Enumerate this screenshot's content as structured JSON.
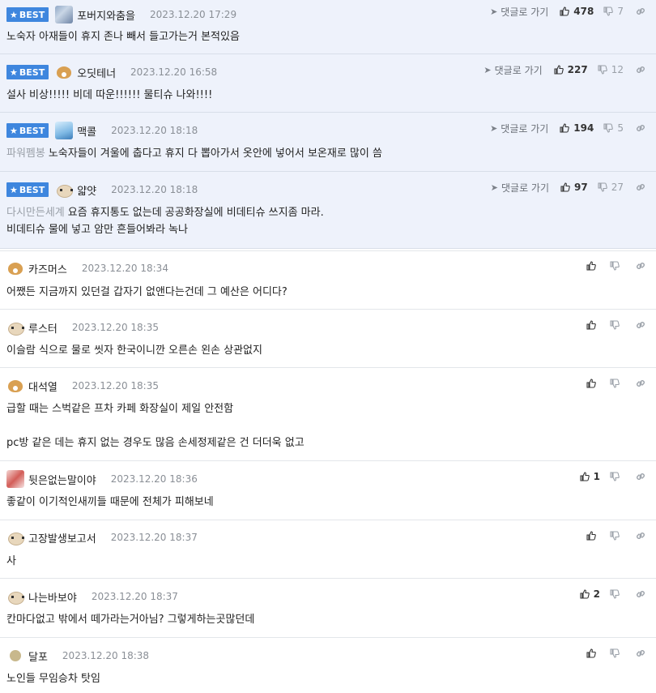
{
  "labels": {
    "best": "BEST",
    "reply": "댓글로 가기"
  },
  "colors": {
    "accent": "#3e86de",
    "best_bg": "#eef2fb"
  },
  "comments": [
    {
      "best": true,
      "avatar": "koala-avatar",
      "nick": "포버지와춤을",
      "date": "2023.12.20 17:29",
      "mention": "",
      "text": "노숙자 아재들이 휴지 존나 빼서 들고가는거 본적있음",
      "up": "478",
      "down": "7"
    },
    {
      "best": true,
      "avatar": "fox-avatar",
      "nick": "오딧테너",
      "date": "2023.12.20 16:58",
      "mention": "",
      "text": "설사 비상!!!!! 비데 따운!!!!!! 물티슈 나와!!!!",
      "up": "227",
      "down": "12"
    },
    {
      "best": true,
      "avatar": "blue-avatar",
      "nick": "맥콜",
      "date": "2023.12.20 18:18",
      "mention": "파워펨봉",
      "text": "노숙자들이 겨울에 춥다고 휴지 다 뽑아가서 옷안에 넣어서 보온재로 많이 씀",
      "up": "194",
      "down": "5"
    },
    {
      "best": true,
      "avatar": "puppy-avatar",
      "nick": "얇얏",
      "date": "2023.12.20 18:18",
      "mention": "다시만든세계",
      "text": "요즘 휴지통도 없는데 공공화장실에 비데티슈 쓰지좀 마라.\n비데티슈 물에 넣고 암만 흔들어봐라 녹나",
      "up": "97",
      "down": "27"
    },
    {
      "best": false,
      "avatar": "fox-avatar",
      "nick": "카즈머스",
      "date": "2023.12.20 18:34",
      "mention": "",
      "text": "어쨌든 지금까지 있던걸 갑자기 없앤다는건데 그 예산은 어디다?",
      "up": "",
      "down": ""
    },
    {
      "best": false,
      "avatar": "puppy-avatar",
      "nick": "루스터",
      "date": "2023.12.20 18:35",
      "mention": "",
      "text": "이슬람 식으로 물로 씻자 한국이니깐 오른손 왼손 상관없지",
      "up": "",
      "down": ""
    },
    {
      "best": false,
      "avatar": "fox-avatar",
      "nick": "대석열",
      "date": "2023.12.20 18:35",
      "mention": "",
      "text": "급할 때는 스벅같은 프차 카페 화장실이 제일 안전함\n\npc방 같은 데는 휴지 없는 경우도 많음 손세정제같은 건 더더욱 없고",
      "up": "",
      "down": ""
    },
    {
      "best": false,
      "avatar": "red-avatar",
      "nick": "뒷은없는말이야",
      "date": "2023.12.20 18:36",
      "mention": "",
      "text": "좋같이 이기적인새끼들 때문에 전체가 피해보네",
      "up": "1",
      "down": ""
    },
    {
      "best": false,
      "avatar": "puppy-avatar",
      "nick": "고장발생보고서",
      "date": "2023.12.20 18:37",
      "mention": "",
      "text": "사",
      "up": "",
      "down": ""
    },
    {
      "best": false,
      "avatar": "puppy-avatar",
      "nick": "나는바보야",
      "date": "2023.12.20 18:37",
      "mention": "",
      "text": "칸마다없고 밖에서 떼가라는거아님? 그렇게하는곳많던데",
      "up": "2",
      "down": ""
    },
    {
      "best": false,
      "avatar": "dot-avatar",
      "nick": "달포",
      "date": "2023.12.20 18:38",
      "mention": "",
      "text": "노인들 무임승차 탓임",
      "up": "",
      "down": ""
    }
  ]
}
